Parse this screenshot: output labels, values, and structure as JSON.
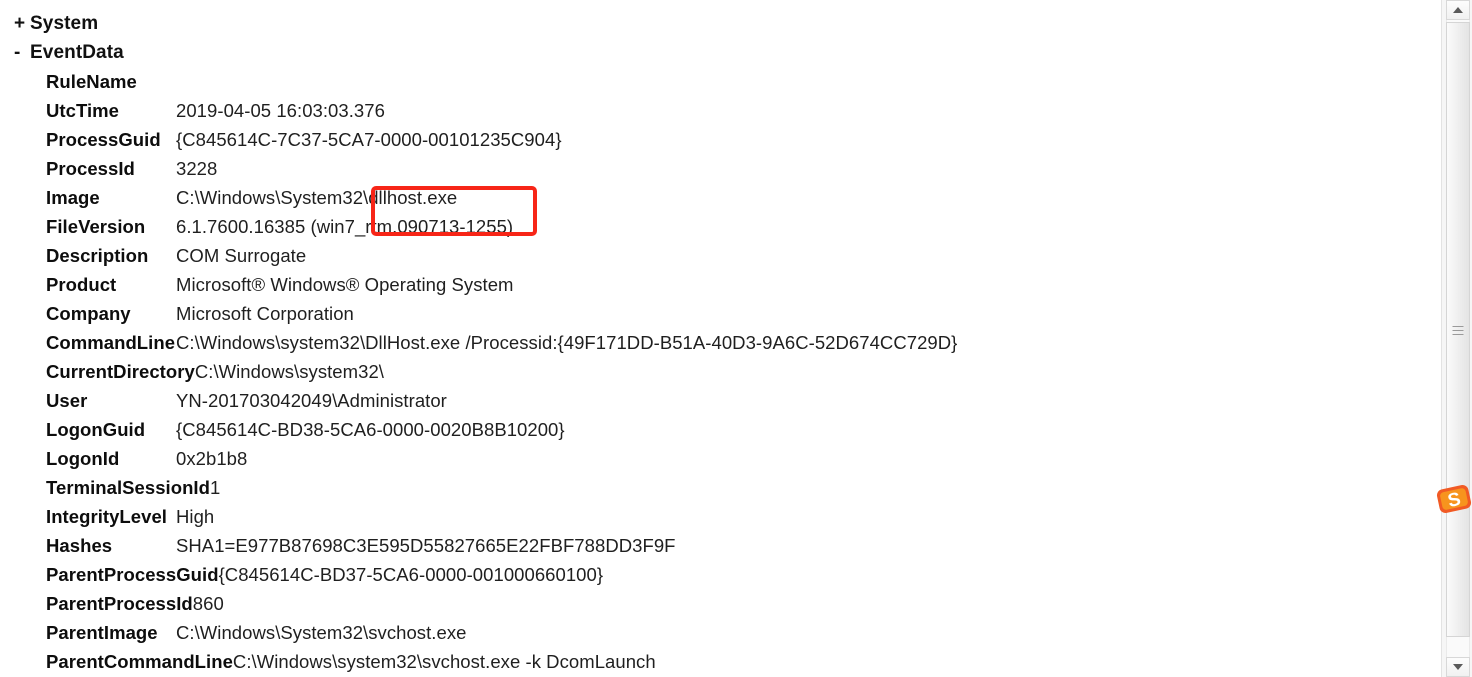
{
  "viewer": {
    "title": "Windows Event Viewer XML details pane"
  },
  "tree": {
    "nodes": [
      {
        "sign": "+",
        "label": "System",
        "expanded": false
      },
      {
        "sign": "-",
        "label": "EventData",
        "expanded": true
      }
    ]
  },
  "event_data": {
    "fields": [
      {
        "name": "RuleName",
        "value": ""
      },
      {
        "name": "UtcTime",
        "value": "2019-04-05 16:03:03.376"
      },
      {
        "name": "ProcessGuid",
        "value": "{C845614C-7C37-5CA7-0000-00101235C904}"
      },
      {
        "name": "ProcessId",
        "value": "3228"
      },
      {
        "name": "Image",
        "value": "C:\\Windows\\System32\\dllhost.exe"
      },
      {
        "name": "FileVersion",
        "value": "6.1.7600.16385 (win7_rtm.090713-1255)"
      },
      {
        "name": "Description",
        "value": "COM Surrogate"
      },
      {
        "name": "Product",
        "value": "Microsoft® Windows® Operating System"
      },
      {
        "name": "Company",
        "value": "Microsoft Corporation"
      },
      {
        "name": "CommandLine",
        "value": "C:\\Windows\\system32\\DllHost.exe /Processid:{49F171DD-B51A-40D3-9A6C-52D674CC729D}"
      },
      {
        "name": "CurrentDirectory",
        "value": "C:\\Windows\\system32\\"
      },
      {
        "name": "User",
        "value": "YN-201703042049\\Administrator"
      },
      {
        "name": "LogonGuid",
        "value": "{C845614C-BD38-5CA6-0000-0020B8B10200}"
      },
      {
        "name": "LogonId",
        "value": "0x2b1b8"
      },
      {
        "name": "TerminalSessionId",
        "value": "1"
      },
      {
        "name": "IntegrityLevel",
        "value": "High"
      },
      {
        "name": "Hashes",
        "value": "SHA1=E977B87698C3E595D55827665E22FBF788DD3F9F"
      },
      {
        "name": "ParentProcessGuid",
        "value": "{C845614C-BD37-5CA6-0000-001000660100}"
      },
      {
        "name": "ParentProcessId",
        "value": "860"
      },
      {
        "name": "ParentImage",
        "value": "C:\\Windows\\System32\\svchost.exe"
      },
      {
        "name": "ParentCommandLine",
        "value": "C:\\Windows\\system32\\svchost.exe -k DcomLaunch"
      }
    ]
  },
  "annotation": {
    "kind": "rectangle-highlight",
    "target_field": "Image",
    "highlighted_text": "32\\dllhost.exe",
    "color": "#f72517"
  },
  "scrollbar": {
    "orientation": "vertical",
    "up_arrow": "scroll-up-arrow",
    "down_arrow": "scroll-down-arrow",
    "position": "near-top"
  },
  "watermark": {
    "label": "S",
    "color": "#f26522"
  }
}
